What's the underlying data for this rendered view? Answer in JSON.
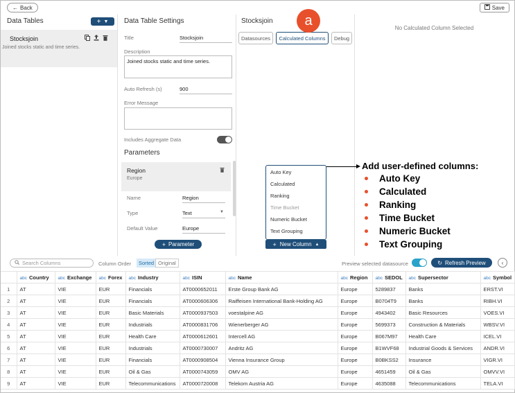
{
  "topbar": {
    "back_label": "Back",
    "save_label": "Save"
  },
  "data_tables": {
    "title": "Data Tables",
    "add_label": "+",
    "item": {
      "name": "Stocksjoin",
      "desc": "Joined stocks static and time series."
    }
  },
  "settings": {
    "title": "Data Table Settings",
    "title_label": "Title",
    "title_value": "Stocksjoin",
    "description_label": "Description",
    "description_value": "Joined stocks static and time series.",
    "auto_refresh_label": "Auto Refresh (s)",
    "auto_refresh_value": "900",
    "error_label": "Error Message",
    "aggregate_label": "Includes Aggregate Data",
    "parameters_title": "Parameters",
    "param": {
      "name": "Region",
      "sub": "Europe",
      "name_label": "Name",
      "name_value": "Region",
      "type_label": "Type",
      "type_value": "Text",
      "default_label": "Default Value",
      "default_value": "Europe"
    },
    "add_param_label": "Parameter"
  },
  "join": {
    "title": "Stocksjoin",
    "tabs": [
      "Datasources",
      "Calculated Columns",
      "Debug"
    ],
    "badge": "a",
    "menu": [
      "Auto Key",
      "Calculated",
      "Ranking",
      "Time Bucket",
      "Numeric Bucket",
      "Text Grouping"
    ],
    "new_column_label": "New Column"
  },
  "right": {
    "empty_text": "No Calculated Column Selected"
  },
  "annotation": {
    "title": "Add user-defined columns:",
    "items": [
      "Auto Key",
      "Calculated",
      "Ranking",
      "Time Bucket",
      "Numeric Bucket",
      "Text Grouping"
    ]
  },
  "grid": {
    "search_placeholder": "Search Columns",
    "column_order_label": "Column Order",
    "sorted_label": "Sorted",
    "original_label": "Original",
    "preview_label": "Preview selected datasource",
    "refresh_label": "Refresh Preview",
    "type_tag": "abc",
    "columns": [
      "Country",
      "Exchange",
      "Forex",
      "Industry",
      "ISIN",
      "Name",
      "Region",
      "SEDOL",
      "Supersector",
      "Symbol"
    ],
    "rows": [
      [
        "1",
        "AT",
        "VIE",
        "EUR",
        "Financials",
        "AT0000652011",
        "Erste Group Bank AG",
        "Europe",
        "5289837",
        "Banks",
        "ERST.VI"
      ],
      [
        "2",
        "AT",
        "VIE",
        "EUR",
        "Financials",
        "AT0000606306",
        "Raiffeisen International Bank-Holding AG",
        "Europe",
        "B0704T9",
        "Banks",
        "RIBH.VI"
      ],
      [
        "3",
        "AT",
        "VIE",
        "EUR",
        "Basic Materials",
        "AT0000937503",
        "voestalpine AG",
        "Europe",
        "4943402",
        "Basic Resources",
        "VOES.VI"
      ],
      [
        "4",
        "AT",
        "VIE",
        "EUR",
        "Industrials",
        "AT0000831706",
        "Wienerberger AG",
        "Europe",
        "5699373",
        "Construction & Materials",
        "WBSV.VI"
      ],
      [
        "5",
        "AT",
        "VIE",
        "EUR",
        "Health Care",
        "AT0000612601",
        "Intercell AG",
        "Europe",
        "B067M97",
        "Health Care",
        "ICEL.VI"
      ],
      [
        "6",
        "AT",
        "VIE",
        "EUR",
        "Industrials",
        "AT0000730007",
        "Andritz AG",
        "Europe",
        "B1WVF68",
        "Industrial Goods & Services",
        "ANDR.VI"
      ],
      [
        "7",
        "AT",
        "VIE",
        "EUR",
        "Financials",
        "AT0000908504",
        "Vienna Insurance Group",
        "Europe",
        "B0BKSS2",
        "Insurance",
        "VIGR.VI"
      ],
      [
        "8",
        "AT",
        "VIE",
        "EUR",
        "Oil & Gas",
        "AT0000743059",
        "OMV AG",
        "Europe",
        "4651459",
        "Oil & Gas",
        "OMVV.VI"
      ],
      [
        "9",
        "AT",
        "VIE",
        "EUR",
        "Telecommunications",
        "AT0000720008",
        "Telekom Austria AG",
        "Europe",
        "4635088",
        "Telecommunications",
        "TELA.VI"
      ]
    ]
  },
  "colors": {
    "primary": "#1f4e79",
    "accent": "#e8502b",
    "toggle_on": "#29a3c9"
  }
}
